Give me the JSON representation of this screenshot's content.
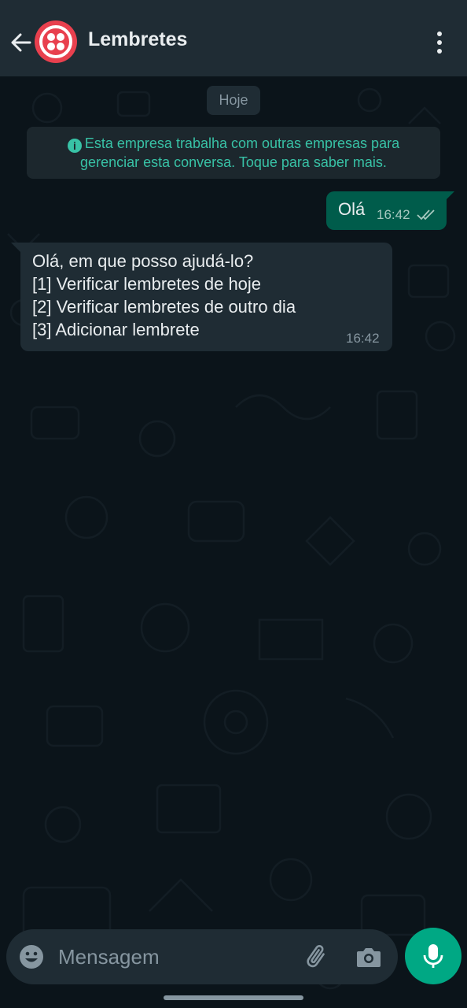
{
  "header": {
    "title": "Lembretes",
    "avatar_icon": "twilio-logo-icon",
    "accent_color": "#e8404e"
  },
  "chat": {
    "date_chip": "Hoje",
    "info_banner": {
      "line1": "Esta empresa trabalha com outras empresas para",
      "line2": "gerenciar esta conversa. Toque para saber mais."
    },
    "messages": [
      {
        "direction": "outgoing",
        "text": "Olá",
        "time": "16:42",
        "status": "delivered"
      },
      {
        "direction": "incoming",
        "lines": [
          "Olá, em que posso ajudá-lo?",
          "[1] Verificar lembretes de hoje",
          "[2] Verificar lembretes de outro dia",
          "[3] Adicionar lembrete"
        ],
        "time": "16:42"
      }
    ]
  },
  "composer": {
    "placeholder": "Mensagem",
    "value": "",
    "mic_color": "#00a884"
  }
}
